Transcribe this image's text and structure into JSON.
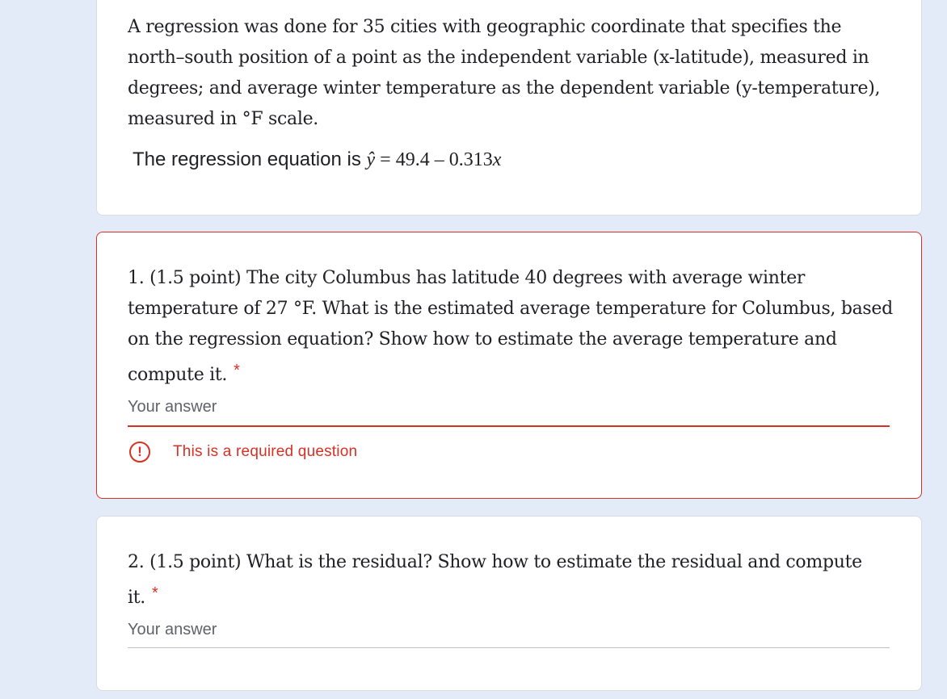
{
  "description": {
    "text": "A regression was done for 35 cities with geographic coordinate that specifies the north–south position of a point as the independent variable (x-latitude), measured in degrees; and average winter temperature as the dependent variable (y-temperature), measured in °F scale.",
    "equation_prefix": "The regression equation is ",
    "equation_yhat": "ŷ",
    "equation_rhs": " = 49.4 – 0.313",
    "equation_x": "x"
  },
  "questions": [
    {
      "text": "1. (1.5 point) The city Columbus has latitude 40 degrees with average winter temperature of 27 °F. What is the estimated average temperature for Columbus, based on the regression equation? Show how to estimate the average temperature and compute it.",
      "required_marker": "*",
      "answer_placeholder": "Your answer",
      "error_icon": "!",
      "error_message": "This is a required question"
    },
    {
      "text": "2. (1.5 point) What is the residual? Show how to estimate the residual and compute it.",
      "required_marker": "*",
      "answer_placeholder": "Your answer"
    }
  ],
  "colors": {
    "background": "#e3ebf8",
    "error": "#d93025",
    "text": "#202124",
    "muted": "#5f6368",
    "divider": "#dadce0"
  }
}
